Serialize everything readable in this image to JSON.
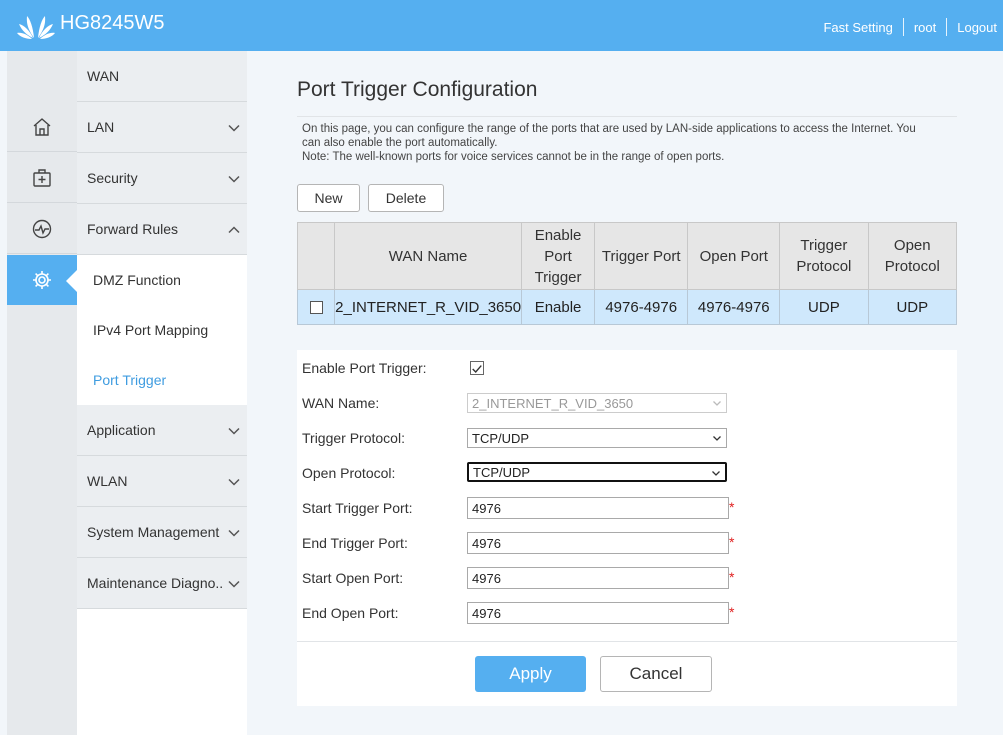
{
  "header": {
    "brand": "HG8245W5",
    "links": {
      "fast_setting": "Fast Setting",
      "user": "root",
      "logout": "Logout"
    },
    "bg_color": "#55aff0"
  },
  "rail": {
    "items": [
      {
        "icon": "home-icon"
      },
      {
        "icon": "first-aid-kit-icon"
      },
      {
        "icon": "pulse-icon"
      },
      {
        "icon": "gear-icon",
        "active": true
      }
    ]
  },
  "menu": {
    "items": [
      {
        "label": "WAN"
      },
      {
        "label": "LAN"
      },
      {
        "label": "Security"
      },
      {
        "label": "Forward Rules",
        "expanded": true
      }
    ],
    "sub_items": [
      {
        "label": "DMZ Function"
      },
      {
        "label": "IPv4 Port Mapping"
      },
      {
        "label": "Port Trigger",
        "active": true
      }
    ],
    "items_after": [
      {
        "label": "Application"
      },
      {
        "label": "WLAN"
      },
      {
        "label": "System Management"
      },
      {
        "label": "Maintenance Diagno.."
      }
    ]
  },
  "main": {
    "title": "Port Trigger Configuration",
    "description_line1": "On this page, you can configure the range of the ports that are used by LAN-side applications to access the Internet. You",
    "description_line2": "can also enable the port automatically.",
    "description_note": "Note: The well-known ports for voice services cannot be in the range of open ports.",
    "buttons": {
      "new": "New",
      "delete": "Delete"
    }
  },
  "table": {
    "headers": {
      "wan_name": "WAN Name",
      "enable_l1": "Enable",
      "enable_l2": "Port",
      "enable_l3": "Trigger",
      "trigger_port": "Trigger Port",
      "open_port": "Open Port",
      "trigger_proto_l1": "Trigger",
      "trigger_proto_l2": "Protocol",
      "open_proto_l1": "Open",
      "open_proto_l2": "Protocol"
    },
    "rows": [
      {
        "wan_name": "2_INTERNET_R_VID_3650",
        "enable": "Enable",
        "trigger_port": "4976-4976",
        "open_port": "4976-4976",
        "trigger_protocol": "UDP",
        "open_protocol": "UDP"
      }
    ]
  },
  "form": {
    "enable_label": "Enable Port Trigger:",
    "enable_checked": true,
    "wan_name_label": "WAN Name:",
    "wan_name_value": "2_INTERNET_R_VID_3650",
    "trigger_protocol_label": "Trigger Protocol:",
    "trigger_protocol_value": "TCP/UDP",
    "open_protocol_label": "Open Protocol:",
    "open_protocol_value": "TCP/UDP",
    "start_trigger_label": "Start Trigger Port:",
    "start_trigger_value": "4976",
    "end_trigger_label": "End Trigger Port:",
    "end_trigger_value": "4976",
    "start_open_label": "Start Open Port:",
    "start_open_value": "4976",
    "end_open_label": "End Open Port:",
    "end_open_value": "4976",
    "required_mark": "*",
    "apply": "Apply",
    "cancel": "Cancel"
  }
}
